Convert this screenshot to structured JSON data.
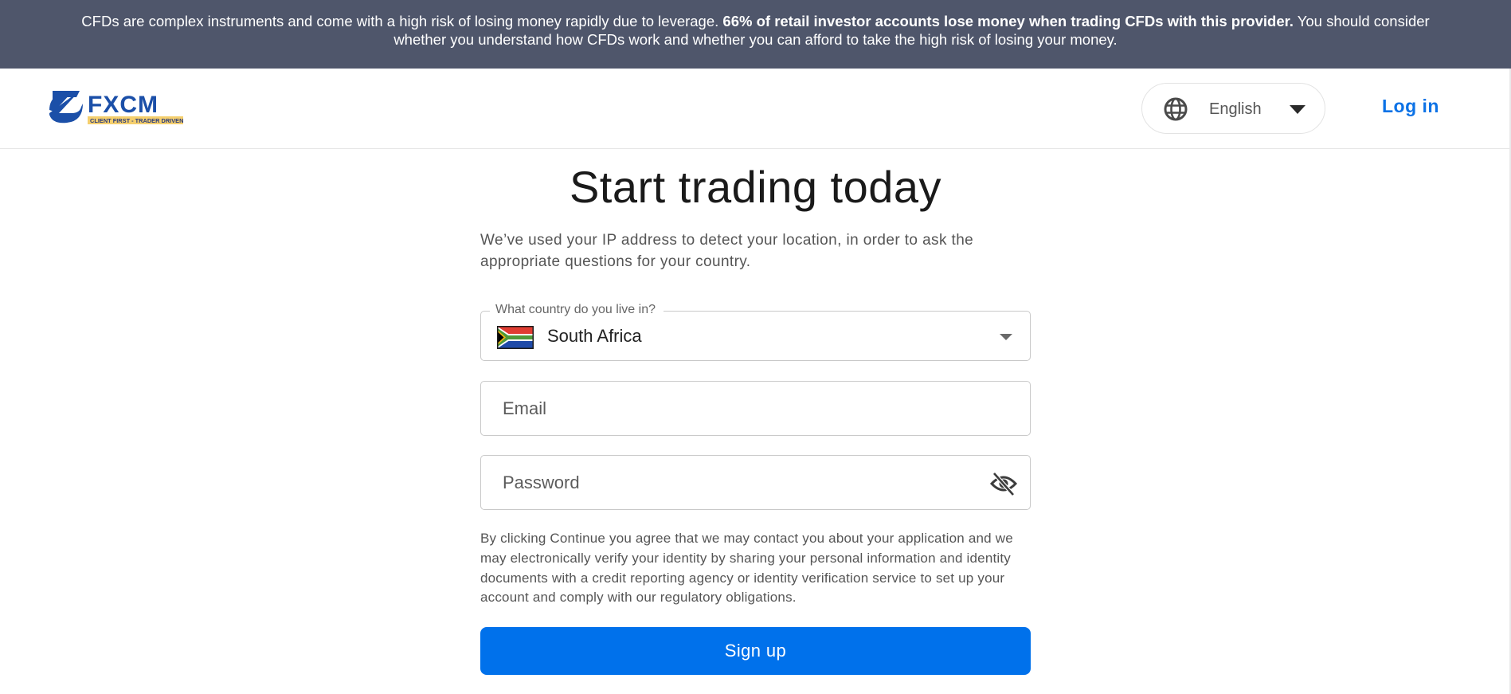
{
  "risk_warning": {
    "text_before": "CFDs are complex instruments and come with a high risk of losing money rapidly due to leverage. ",
    "text_bold": "66% of retail investor accounts lose money when trading CFDs with this provider.",
    "text_after": " You should consider whether you understand how CFDs work and whether you can afford to take the high risk of losing your money."
  },
  "header": {
    "logo": {
      "wordmark": "FXCM",
      "tagline": "CLIENT FIRST - TRADER DRIVEN",
      "brand_color": "#1b4fa8",
      "tagline_bg": "#f5cf6e"
    },
    "language": {
      "icon": "globe-icon",
      "selected": "English",
      "caret_icon": "caret-down-icon"
    },
    "login_label": "Log in"
  },
  "main": {
    "title": "Start trading today",
    "intro": "We’ve used your IP address to detect your location, in order to ask the appropriate questions for your country.",
    "country_field": {
      "label": "What country do you live in?",
      "value": "South Africa",
      "flag_icon": "south-africa-flag-icon",
      "caret_icon": "caret-down-icon"
    },
    "email_field": {
      "placeholder": "Email",
      "value": ""
    },
    "password_field": {
      "placeholder": "Password",
      "value": "",
      "toggle_icon": "eye-off-icon"
    },
    "consent_text": "By clicking Continue you agree that we may contact you about your application and we may electronically verify your identity by sharing your personal information and identity documents with a credit reporting agency or identity verification service to set up your account and comply with our regulatory obligations.",
    "signup_label": "Sign up"
  },
  "colors": {
    "banner_bg": "#4f566b",
    "primary": "#0071eb",
    "link": "#0c72e6"
  }
}
